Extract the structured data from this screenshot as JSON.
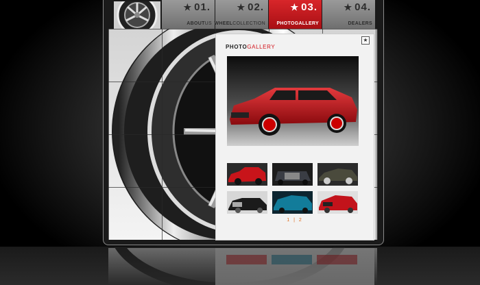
{
  "nav": [
    {
      "num": "01.",
      "label_bold": "ABOUT",
      "label_light": "US",
      "active": false
    },
    {
      "num": "02.",
      "label_bold": "WHEEL",
      "label_light": "COLLECTION",
      "active": false
    },
    {
      "num": "03.",
      "label_bold": "PHOTO",
      "label_light": "GALLERY",
      "active": true
    },
    {
      "num": "04.",
      "label_bold": "DEALERS",
      "label_light": "",
      "active": false
    }
  ],
  "nav_star": "★",
  "panel": {
    "title_bold": "PHOTO",
    "title_accent": "GALLERY",
    "close_symbol": "★",
    "pager": "1 | 2"
  },
  "colors": {
    "accent_red": "#d3131a",
    "nav_grey": "#8a8a8a",
    "pager_orange": "#e06a1a"
  },
  "thumbnails": [
    {
      "color": "#c8141a",
      "bg": "#2a2a2a",
      "icon": "red-magnum-thumb"
    },
    {
      "color": "#3a3d44",
      "bg": "#1c1c1c",
      "icon": "grey-300c-thumb"
    },
    {
      "color": "#4a4a3c",
      "bg": "#2b2b2b",
      "icon": "dark-charger-thumb"
    },
    {
      "color": "#1b1b1b",
      "bg": "#d7d7d7",
      "icon": "black-300c-thumb"
    },
    {
      "color": "#127c9a",
      "bg": "#0c2530",
      "icon": "blue-magnum-thumb"
    },
    {
      "color": "#c3131b",
      "bg": "#dfdfdf",
      "icon": "red-magnum-front-thumb"
    }
  ]
}
